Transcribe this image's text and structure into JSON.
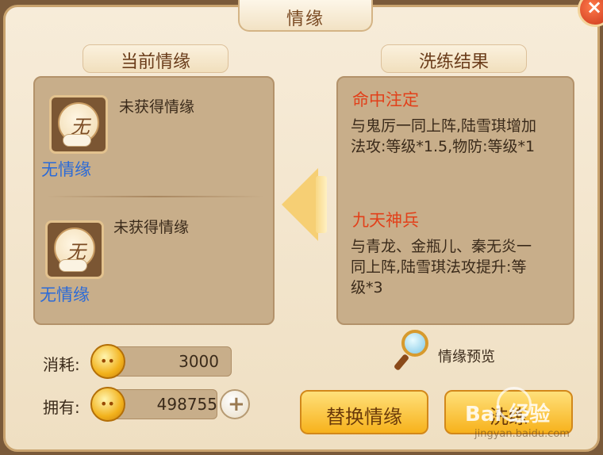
{
  "window": {
    "title": "情缘",
    "close_icon": "close-icon"
  },
  "current": {
    "heading": "当前情缘",
    "slots": [
      {
        "icon_char": "无",
        "status": "未获得情缘",
        "name": "无情缘"
      },
      {
        "icon_char": "无",
        "status": "未获得情缘",
        "name": "无情缘"
      }
    ]
  },
  "result": {
    "heading": "洗练结果",
    "items": [
      {
        "title": "命中注定",
        "line1": "与鬼厉一同上阵,陆雪琪增加",
        "line2": "法攻:等级*1.5,物防:等级*1"
      },
      {
        "title": "九天神兵",
        "line1": "与青龙、金瓶儿、秦无炎一",
        "line2": "同上阵,陆雪琪法攻提升:等",
        "line3": "级*3"
      }
    ]
  },
  "preview_label": "情缘预览",
  "cost": {
    "label": "消耗:",
    "value": "3000"
  },
  "owned": {
    "label": "拥有:",
    "value": "498755"
  },
  "buttons": {
    "replace": "替换情缘",
    "refine": "洗练"
  },
  "watermark": {
    "brand": "Bai  经验",
    "url": "jingyan.baidu.com"
  },
  "colors": {
    "accent_red": "#e2401a",
    "fate_name_blue": "#2a6ad8",
    "button_gold": "#f7b21c"
  }
}
